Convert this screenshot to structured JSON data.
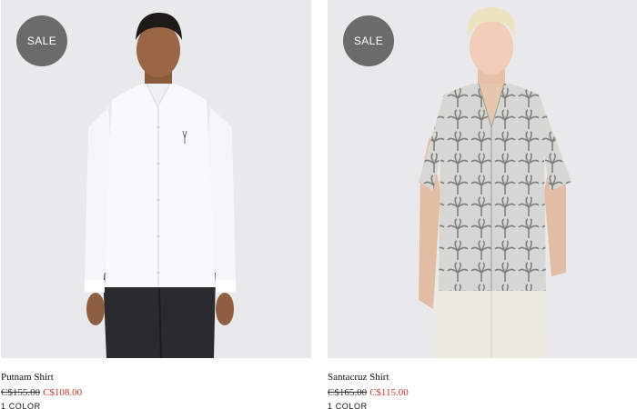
{
  "products": [
    {
      "badge": "SALE",
      "name": "Putnam Shirt",
      "price_was": "C$155.00",
      "price_now": "C$108.00",
      "colors": "1 COLOR"
    },
    {
      "badge": "SALE",
      "name": "Santacruz Shirt",
      "price_was": "C$165.00",
      "price_now": "C$115.00",
      "colors": "1 COLOR"
    }
  ],
  "colors": {
    "photo_background": "#e9e9eb",
    "badge_background": "#6b6b6b",
    "sale_price": "#c0392b"
  }
}
